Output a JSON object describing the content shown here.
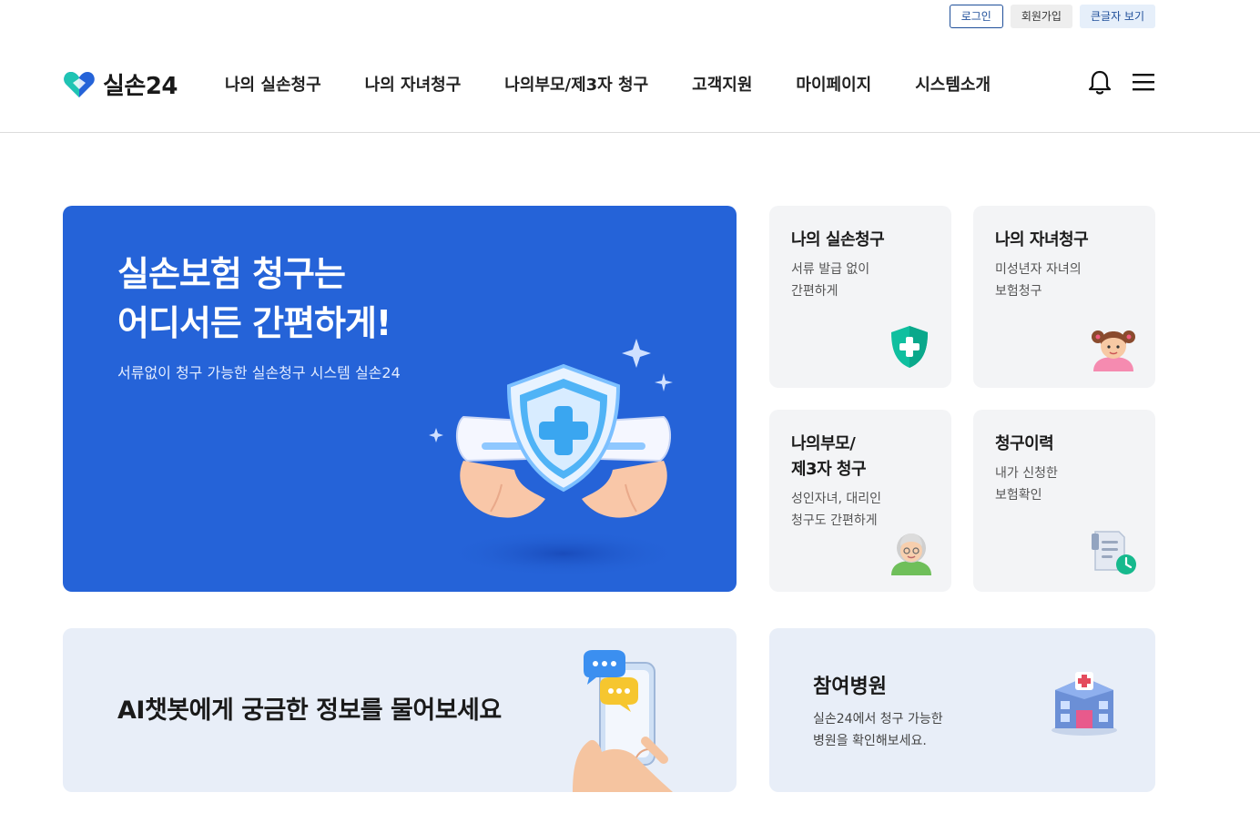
{
  "util": {
    "login": "로그인",
    "join": "회원가입",
    "big_text": "큰글자 보기"
  },
  "header": {
    "logo_text": "실손24",
    "logo_icon": "heart-logo-icon",
    "nav": [
      {
        "label": "나의 실손청구"
      },
      {
        "label": "나의 자녀청구"
      },
      {
        "label": "나의부모/제3자 청구"
      },
      {
        "label": "고객지원"
      },
      {
        "label": "마이페이지"
      },
      {
        "label": "시스템소개"
      }
    ],
    "icons": [
      "bell-icon",
      "hamburger-menu-icon"
    ]
  },
  "hero": {
    "title": "실손보험 청구는\n어디서든 간편하게!",
    "subtitle": "서류없이 청구 가능한 실손청구 시스템 실손24"
  },
  "cards": [
    {
      "title": "나의 실손청구",
      "desc": "서류 발급 없이\n간편하게",
      "icon": "shield-plus-icon"
    },
    {
      "title": "나의 자녀청구",
      "desc": "미성년자 자녀의\n보험청구",
      "icon": "child-avatar-icon"
    },
    {
      "title": "나의부모/\n제3자 청구",
      "desc": "성인자녀, 대리인\n청구도 간편하게",
      "icon": "elder-avatar-icon"
    },
    {
      "title": "청구이력",
      "desc": "내가 신청한\n보험확인",
      "icon": "document-clock-icon"
    }
  ],
  "chatbot": {
    "title": "AI챗봇에게 궁금한 정보를 물어보세요"
  },
  "hospital": {
    "title": "참여병원",
    "desc": "실손24에서 청구 가능한\n병원을 확인해보세요."
  },
  "colors": {
    "brand_blue": "#2563d8",
    "teal": "#14b8a6",
    "card_bg": "#f3f4f6",
    "banner_bg": "#e8eef8"
  }
}
